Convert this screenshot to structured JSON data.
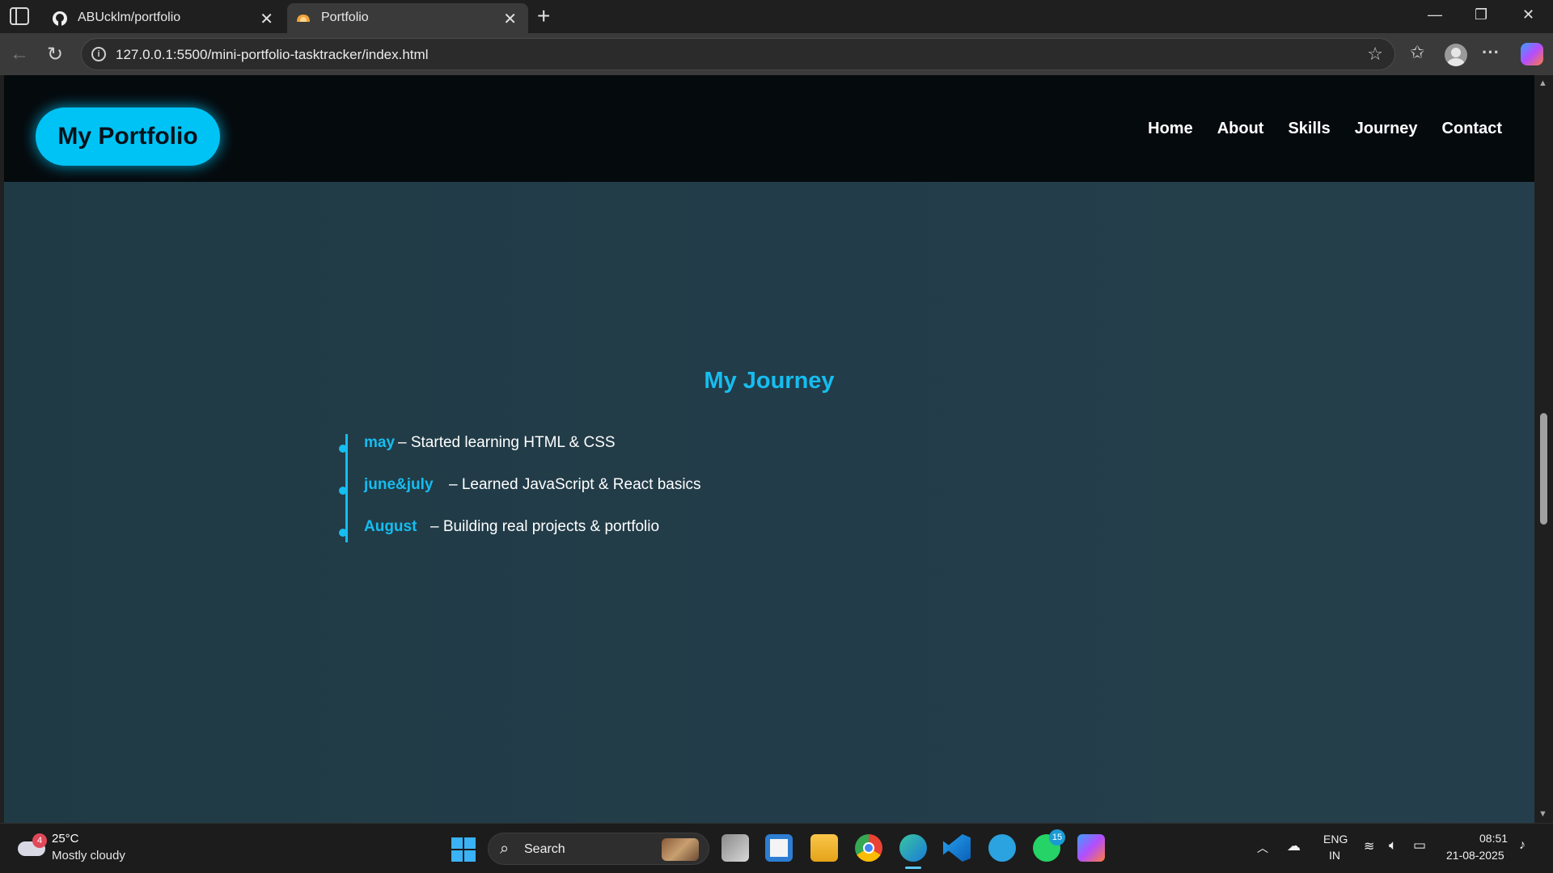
{
  "browser": {
    "tabs": [
      {
        "title": "ABUcklm/portfolio",
        "favicon": "github-icon",
        "active": false
      },
      {
        "title": "Portfolio",
        "favicon": "portfolio-favicon",
        "active": true
      }
    ],
    "new_tab_symbol": "+",
    "close_symbol": "✕",
    "window_controls": {
      "minimize": "—",
      "restore": "❐",
      "close": "✕"
    },
    "url": "127.0.0.1:5500/mini-portfolio-tasktracker/index.html",
    "icons": {
      "back": "←",
      "reload": "↻",
      "info": "i",
      "star": "☆",
      "favorites": "✩",
      "more": "···"
    }
  },
  "site": {
    "logo": "My Portfolio",
    "nav": [
      "Home",
      "About",
      "Skills",
      "Journey",
      "Contact"
    ],
    "journey": {
      "title": "My Journey",
      "items": [
        {
          "when": "may",
          "text": "– Started learning HTML & CSS"
        },
        {
          "when": "june&july",
          "text": "– Learned JavaScript & React basics"
        },
        {
          "when": "August",
          "text": "– Building real projects & portfolio"
        }
      ]
    },
    "accent_color": "#16bdf0",
    "background_color": "#223d49"
  },
  "taskbar": {
    "weather": {
      "badge": "4",
      "temp": "25°C",
      "condition": "Mostly cloudy"
    },
    "search_label": "Search",
    "whatsapp_badge": "15",
    "language": {
      "line1": "ENG",
      "line2": "IN"
    },
    "clock": {
      "time": "08:51",
      "date": "21-08-2025"
    }
  }
}
